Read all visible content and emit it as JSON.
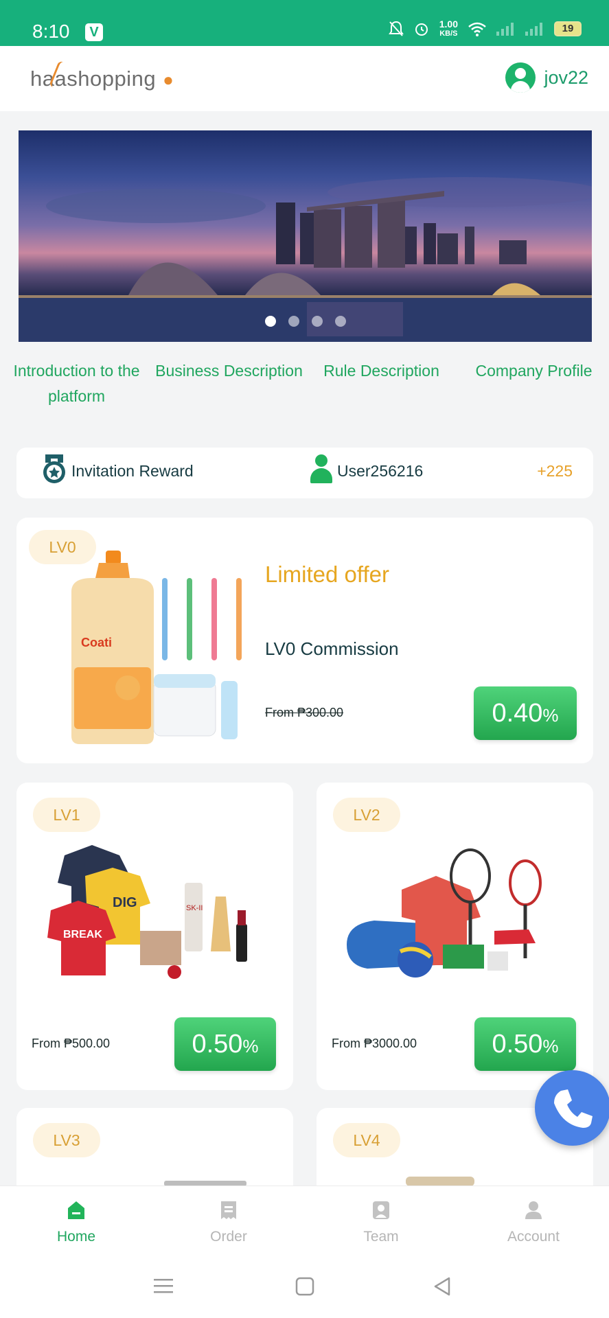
{
  "status_bar": {
    "time": "8:10",
    "app_badge": "V",
    "net_speed_value": "1.00",
    "net_speed_unit": "KB/S",
    "battery": "19"
  },
  "header": {
    "logo_text": "haashopping",
    "username": "jov22"
  },
  "banner": {
    "slides": 4,
    "active_slide": 1
  },
  "quick_links": [
    {
      "label": "Introduction to the platform"
    },
    {
      "label": "Business Description"
    },
    {
      "label": "Rule Description"
    },
    {
      "label": "Company Profile"
    }
  ],
  "notice": {
    "label": "Invitation Reward",
    "user": "User256216",
    "amount": "+225"
  },
  "levels": {
    "lv0": {
      "badge": "LV0",
      "title": "Limited offer",
      "commission_label": "LV0 Commission",
      "from": "From ₱300.00",
      "rate": "0.40",
      "unit": "%"
    },
    "lv1": {
      "badge": "LV1",
      "from": "From ₱500.00",
      "rate": "0.50",
      "unit": "%"
    },
    "lv2": {
      "badge": "LV2",
      "from": "From ₱3000.00",
      "rate": "0.50",
      "unit": "%"
    },
    "lv3": {
      "badge": "LV3"
    },
    "lv4": {
      "badge": "LV4"
    }
  },
  "tabbar": [
    {
      "label": "Home",
      "active": true
    },
    {
      "label": "Order",
      "active": false
    },
    {
      "label": "Team",
      "active": false
    },
    {
      "label": "Account",
      "active": false
    }
  ],
  "colors": {
    "brand_green": "#17b07c",
    "accent_gold": "#e6a620",
    "call_blue": "#4b82e6"
  }
}
